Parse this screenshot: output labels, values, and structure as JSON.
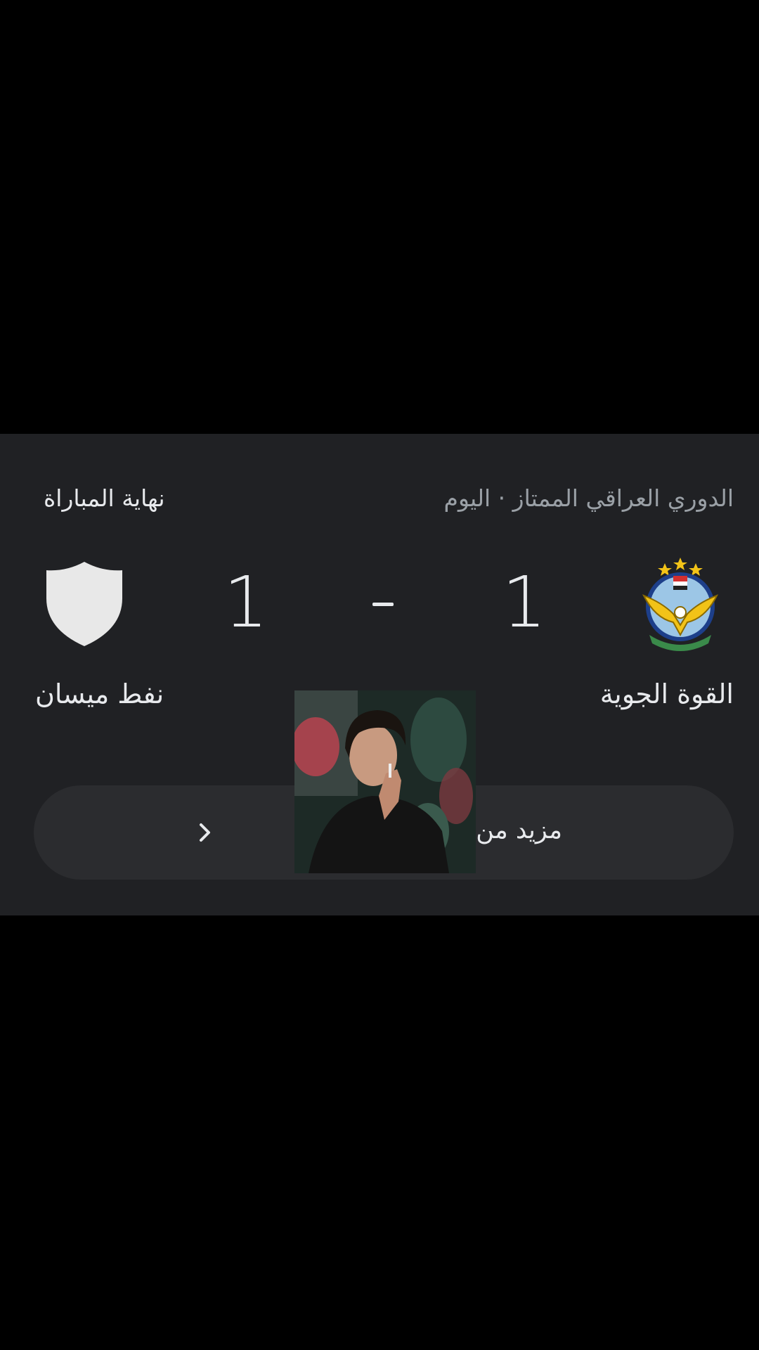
{
  "match": {
    "league_label": "الدوري العراقي الممتاز · اليوم",
    "status": "نهاية المباراة",
    "home_team": "القوة الجوية",
    "away_team": "نفط ميسان",
    "home_score": "1",
    "away_score": "1",
    "more_button_label": "مزيد من الـ          اللعبة"
  },
  "icons": {
    "home_logo": "air-force-club-crest",
    "away_logo": "generic-shield",
    "chevron": "chevron-right"
  },
  "colors": {
    "card_background": "#202124",
    "button_background": "#2b2c2f",
    "primary_text": "#e8eaed",
    "secondary_text": "#9aa0a6",
    "shield": "#e8e8e8",
    "crest_gold": "#f2c318",
    "crest_blue": "#1d3f8a"
  }
}
